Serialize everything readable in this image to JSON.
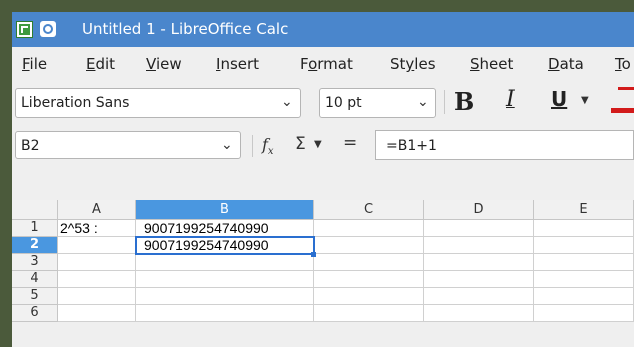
{
  "window": {
    "title": "Untitled 1 - LibreOffice Calc"
  },
  "menubar": {
    "items": [
      {
        "label": "File",
        "accel": "F",
        "rest": "ile"
      },
      {
        "label": "Edit",
        "accel": "E",
        "rest": "dit"
      },
      {
        "label": "View",
        "accel": "V",
        "rest": "iew"
      },
      {
        "label": "Insert",
        "accel": "I",
        "rest": "nsert"
      },
      {
        "label": "Format",
        "pre": "F",
        "accel": "o",
        "rest": "rmat"
      },
      {
        "label": "Styles",
        "pre": "St",
        "accel": "y",
        "rest": "les"
      },
      {
        "label": "Sheet",
        "accel": "S",
        "rest": "heet"
      },
      {
        "label": "Data",
        "accel": "D",
        "rest": "ata"
      },
      {
        "label": "To",
        "accel": "T",
        "rest": "o"
      }
    ]
  },
  "format_toolbar": {
    "font_name": "Liberation Sans",
    "font_size": "10 pt",
    "bold_label": "B",
    "italic_label": "I",
    "underline_label": "U",
    "font_color": "#d21a1a"
  },
  "formula_bar": {
    "name_box": "B2",
    "function_wizard_icon": "fx-icon",
    "sum_icon": "sigma-icon",
    "equals_label": "=",
    "formula": "=B1+1"
  },
  "sheet": {
    "columns": [
      "A",
      "B",
      "C",
      "D",
      "E"
    ],
    "rows": [
      "1",
      "2",
      "3",
      "4",
      "5",
      "6"
    ],
    "selected_cell": "B2",
    "cells": {
      "A1": "2^53 :",
      "B1": "9007199254740990",
      "B2": "9007199254740990"
    },
    "selection_color": "#4a97e0"
  }
}
